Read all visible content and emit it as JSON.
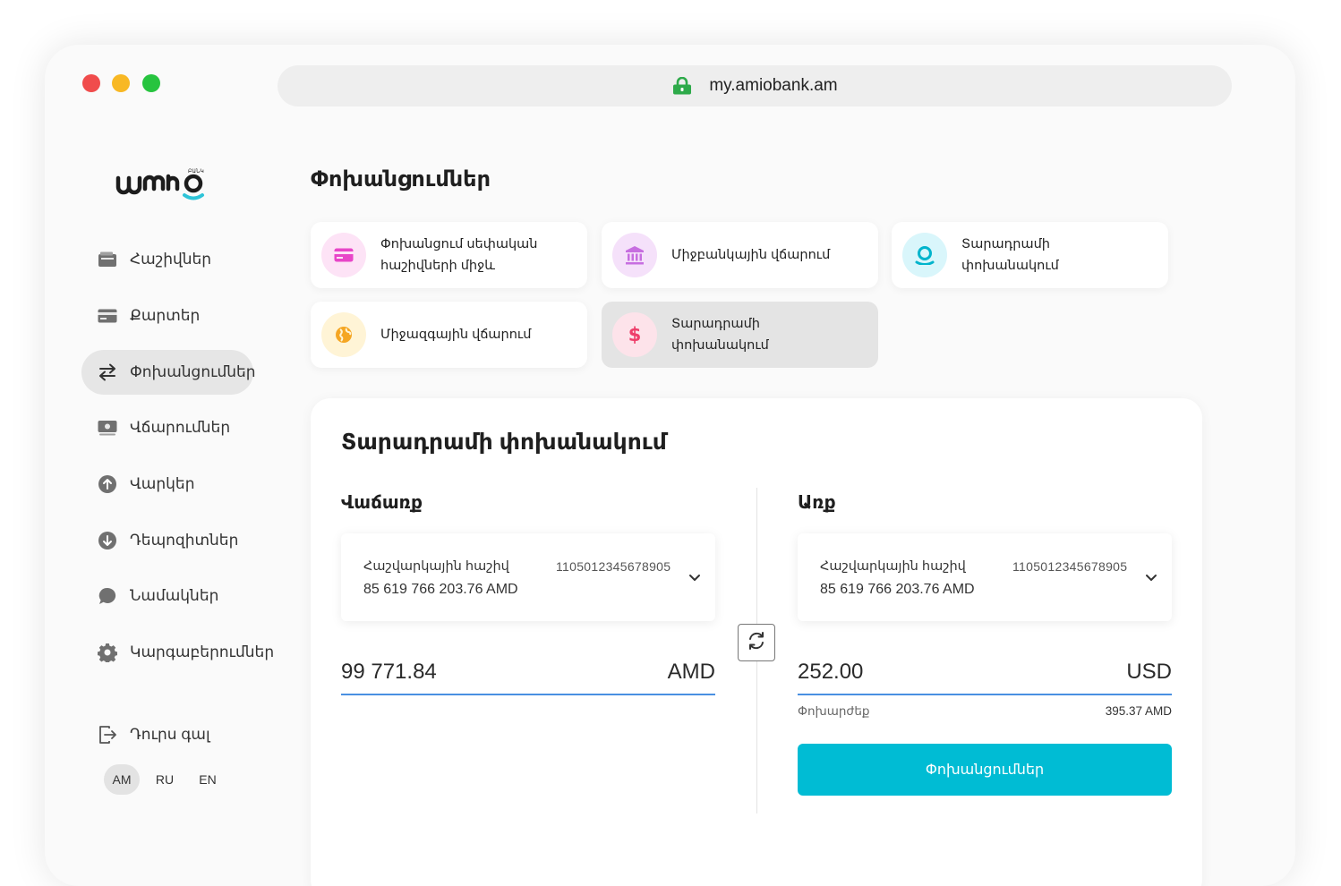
{
  "browser": {
    "url": "my.amiobank.am"
  },
  "brand": {
    "logo_text": "ᴜᴍɪᴏ",
    "accent": "#00bcd4"
  },
  "sidebar": {
    "items": [
      {
        "label": "Հաշիվներ",
        "icon": "wallet-icon"
      },
      {
        "label": "Քարտեր",
        "icon": "card-icon"
      },
      {
        "label": "Փոխանցումներ",
        "icon": "transfer-arrows-icon",
        "active": true
      },
      {
        "label": "Վճարումներ",
        "icon": "cash-icon"
      },
      {
        "label": "Վարկեր",
        "icon": "arrow-up-circle-icon"
      },
      {
        "label": "Դեպոզիտներ",
        "icon": "arrow-down-circle-icon"
      },
      {
        "label": "Նամակներ",
        "icon": "chat-bubble-icon"
      },
      {
        "label": "Կարգաբերումներ",
        "icon": "gear-icon"
      }
    ],
    "logout": {
      "label": "Դուրս գալ",
      "icon": "logout-icon"
    },
    "languages": [
      {
        "label": "AM",
        "active": true
      },
      {
        "label": "RU"
      },
      {
        "label": "EN"
      }
    ]
  },
  "main": {
    "title": "Փոխանցումներ",
    "tiles": [
      {
        "label": "Փոխանցում սեփական հաշիվների միջև",
        "icon": "card-icon",
        "bg": "#fde3f6",
        "fg": "#e846c8"
      },
      {
        "label": "Միջբանկային վճարում",
        "icon": "bank-icon",
        "bg": "#f5e1fa",
        "fg": "#c76ee0"
      },
      {
        "label": "Տարադրամի փոխանակում",
        "icon": "exchange-icon",
        "bg": "#d9f6fb",
        "fg": "#00b4cc"
      },
      {
        "label": "Միջազգային վճարում",
        "icon": "globe-icon",
        "bg": "#fff4d6",
        "fg": "#f5a623"
      },
      {
        "label": "Տարադրամի փոխանակում",
        "icon": "dollar-icon",
        "bg": "#fde3ea",
        "fg": "#ee3e6a",
        "active": true
      }
    ],
    "exchange": {
      "title": "Տարադրամի փոխանակում",
      "sell": {
        "title": "Վաճառք",
        "account_type": "Հաշվարկային հաշիվ",
        "account_number": "1105012345678905",
        "balance": "85 619 766 203.76 AMD",
        "amount": "99 771.84",
        "currency": "AMD"
      },
      "buy": {
        "title": "Առք",
        "account_type": "Հաշվարկային հաշիվ",
        "account_number": "1105012345678905",
        "balance": "85 619 766 203.76 AMD",
        "amount": "252.00",
        "currency": "USD"
      },
      "rate_label": "Փոխարժեք",
      "rate_value": "395.37 AMD",
      "submit_label": "Փոխանցումներ"
    }
  }
}
